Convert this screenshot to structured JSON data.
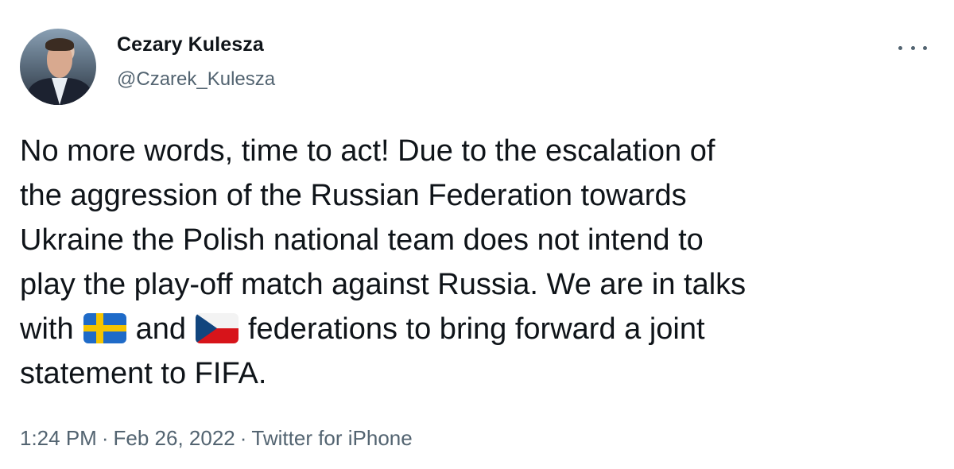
{
  "author": {
    "name": "Cezary Kulesza",
    "handle": "@Czarek_Kulesza"
  },
  "tweet": {
    "lines": [
      "No more words, time to act! Due to the escalation of",
      "the aggression of the Russian Federation towards",
      "Ukraine the Polish national team does not intend to",
      "play the play-off match against Russia. We are in talks"
    ],
    "line5_part1": "with",
    "line5_part2": "and",
    "line5_part3": "federations to bring forward a joint",
    "line6": "statement to FIFA.",
    "flag1_icon": "sweden-flag-icon",
    "flag2_icon": "czech-flag-icon"
  },
  "meta": {
    "time": "1:24 PM",
    "date": "Feb 26, 2022",
    "source": "Twitter for iPhone",
    "separator": "·"
  },
  "icons": {
    "more": "more-options-icon"
  },
  "colors": {
    "text": "#0f1419",
    "secondary": "#536471",
    "background": "#ffffff"
  }
}
